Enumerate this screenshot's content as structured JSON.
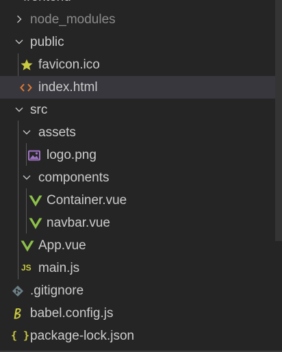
{
  "explorer": {
    "partial_top_label": "frontend",
    "tree": {
      "node_modules": "node_modules",
      "public": "public",
      "favicon": "favicon.ico",
      "index_html": "index.html",
      "src": "src",
      "assets": "assets",
      "logo": "logo.png",
      "components": "components",
      "container_vue": "Container.vue",
      "navbar_vue": "navbar.vue",
      "app_vue": "App.vue",
      "main_js": "main.js",
      "gitignore": ".gitignore",
      "babel_config": "babel.config.js",
      "package_lock": "package-lock.json"
    },
    "badges": {
      "js": "JS",
      "json": "{ }"
    },
    "colors": {
      "background": "#252526",
      "selected_row": "#37373d",
      "text": "#cccccc",
      "dim_text": "#8b8b8b",
      "vue_green": "#8dc149",
      "html_orange": "#e37933",
      "favicon_yellow": "#cbcb41",
      "image_purple": "#a074c4",
      "git_gray": "#6d8086"
    }
  }
}
